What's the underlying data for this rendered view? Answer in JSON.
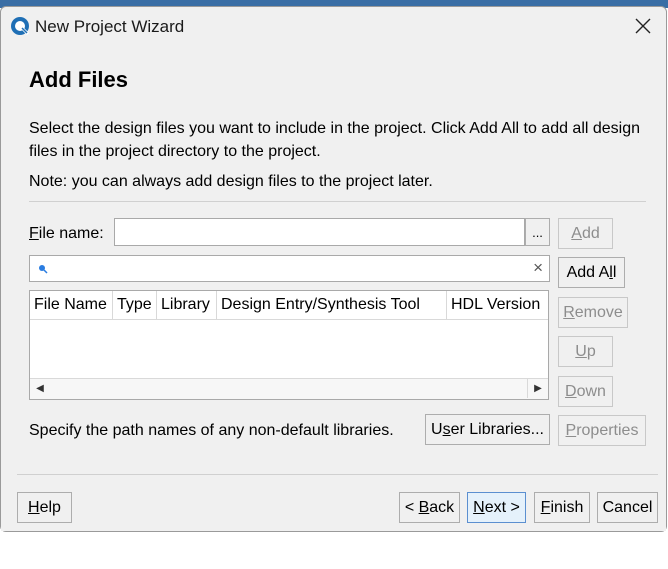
{
  "window": {
    "title": "New Project Wizard"
  },
  "page": {
    "heading": "Add Files",
    "description": "Select the design files you want to include in the project. Click Add All to add all design files in the project directory to the project.",
    "note": "Note: you can always add design files to the project later."
  },
  "file_name": {
    "label_mnemonic": "F",
    "label_rest": "ile name:",
    "value": "",
    "browse_label": "..."
  },
  "filter": {
    "value": "",
    "clear_label": "×"
  },
  "table": {
    "columns": [
      "File Name",
      "Type",
      "Library",
      "Design Entry/Synthesis Tool",
      "HDL Version"
    ],
    "rows": []
  },
  "side_buttons": {
    "add": {
      "m": "A",
      "rest": "dd"
    },
    "add_all": {
      "pre": "Add A",
      "m": "l",
      "post": "l"
    },
    "remove": {
      "m": "R",
      "rest": "emove"
    },
    "up": {
      "m": "U",
      "rest": "p"
    },
    "down": {
      "m": "D",
      "rest": "own"
    },
    "properties": {
      "m": "P",
      "rest": "roperties"
    }
  },
  "libraries": {
    "text": "Specify the path names of any non-default libraries.",
    "button_pre": "U",
    "button_m": "s",
    "button_post": "er Libraries..."
  },
  "footer": {
    "help": {
      "m": "H",
      "rest": "elp"
    },
    "back": {
      "pre": "< ",
      "m": "B",
      "rest": "ack"
    },
    "next": {
      "m": "N",
      "rest": "ext >"
    },
    "finish": {
      "m": "F",
      "rest": "inish"
    },
    "cancel": "Cancel"
  }
}
